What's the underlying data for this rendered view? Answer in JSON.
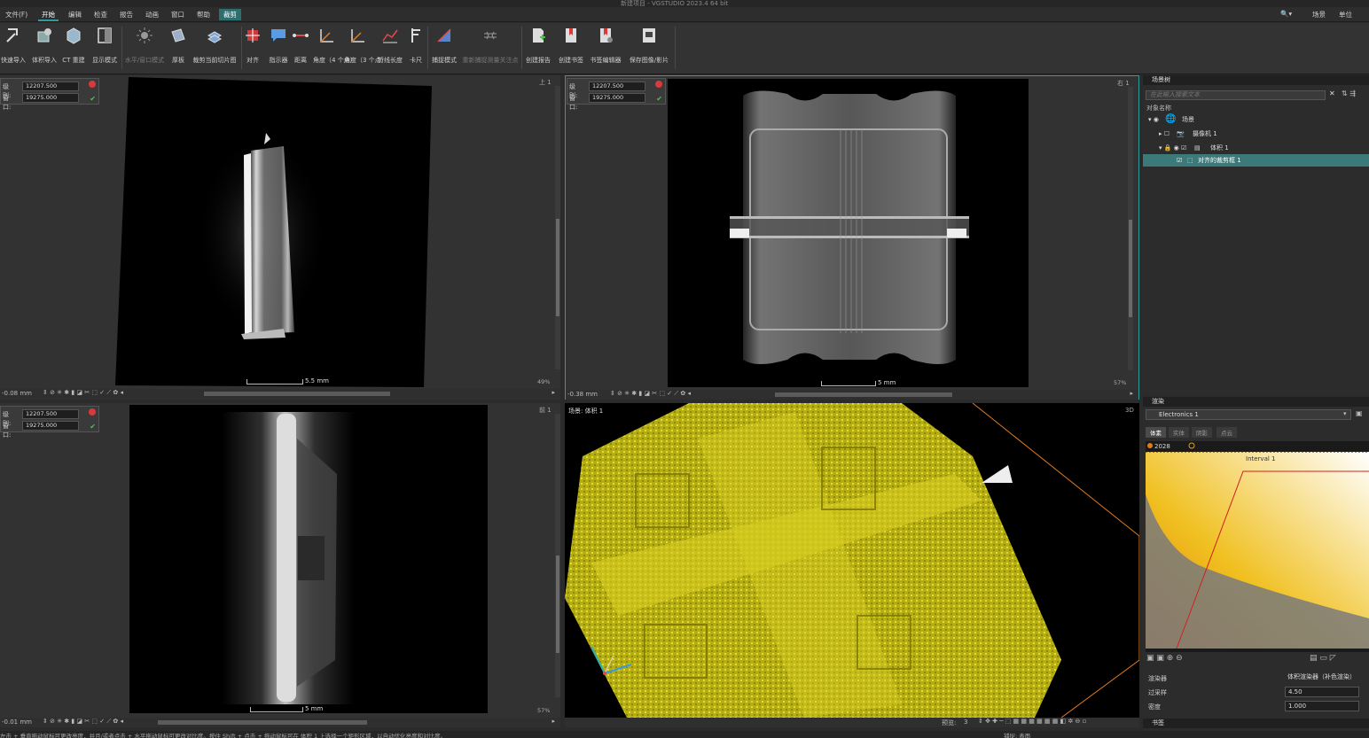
{
  "titlebar": {
    "title": "新建项目 - VGSTUDIO 2023.4 64 bit"
  },
  "menu": {
    "items": [
      "文件(F)",
      "开始",
      "编辑",
      "检查",
      "报告",
      "动画",
      "窗口",
      "帮助",
      "裁剪"
    ],
    "right_scene": "场景",
    "right_units": "单位"
  },
  "ribbon": {
    "buttons": [
      {
        "label": "快速导入"
      },
      {
        "label": "体积导入"
      },
      {
        "label": "CT 重建"
      },
      {
        "label": "显示模式"
      },
      {
        "label": "水平/窗口模式"
      },
      {
        "label": "厚板"
      },
      {
        "label": "裁剪当前切片图"
      },
      {
        "label": "对齐"
      },
      {
        "label": "指示器"
      },
      {
        "label": "距离"
      },
      {
        "label": "角度（4 个点）"
      },
      {
        "label": "角度（3 个点）"
      },
      {
        "label": "折线长度"
      },
      {
        "label": "卡尺"
      },
      {
        "label": "捕捉模式"
      },
      {
        "label": "重新捕捉测量关注点"
      },
      {
        "label": "创建报告"
      },
      {
        "label": "创建书签"
      },
      {
        "label": "书签编辑器"
      },
      {
        "label": "保存图像/影片"
      }
    ]
  },
  "viewports": {
    "level_label": "级别:",
    "window_label": "窗口:",
    "level_value": "12207.500",
    "window_value": "19275.000",
    "top_left": {
      "corner": "上 1",
      "scale": "5.5 mm",
      "zoom": "49%",
      "offset": "-0.08 mm"
    },
    "top_right": {
      "corner": "右 1",
      "scale": "5 mm",
      "zoom": "57%",
      "offset": "-0.38 mm"
    },
    "bottom_left": {
      "corner": "前 1",
      "scale": "5 mm",
      "zoom": "57%",
      "offset": "-0.01 mm"
    },
    "bottom_right": {
      "corner": "3D",
      "label": "场景: 体积 1",
      "preview_label": "预览:",
      "preview_value": "3"
    }
  },
  "scene_tree": {
    "header": "场景树",
    "search_placeholder": "在此输入搜索文本",
    "column": "对象名称",
    "rows": [
      {
        "label": "场景"
      },
      {
        "label": "摄像机 1"
      },
      {
        "label": "体积 1"
      },
      {
        "label": "对齐的裁剪框 1"
      }
    ]
  },
  "render_panel": {
    "header": "渲染",
    "preset": "Electronics 1",
    "tabs": [
      "体素",
      "实体",
      "阴影",
      "点云"
    ],
    "histogram_min": "2028",
    "interval": "Interval 1",
    "props": [
      {
        "key": "渲染器",
        "value": "体积渲染器（补色渲染）"
      },
      {
        "key": "过采样",
        "value": "4.50"
      },
      {
        "key": "密度",
        "value": "1.000"
      }
    ],
    "bookmarks": "书签",
    "colors": {
      "accent": "#2f9b9b",
      "selection": "#3c7a7a",
      "volume": "#d4cc1a",
      "clip_box": "#e07a20"
    }
  },
  "statusbar": {
    "hint": "左击 + 垂直拖动鼠标可更改亮度，并且/或者点击 + 水平拖动鼠标可更改对比度。按住 Shift + 点击 + 拖动鼠标可在 体积 1 上选择一个矩形区域，以自动优化亮度和对比度。",
    "mode": "捕捉: 表面"
  }
}
